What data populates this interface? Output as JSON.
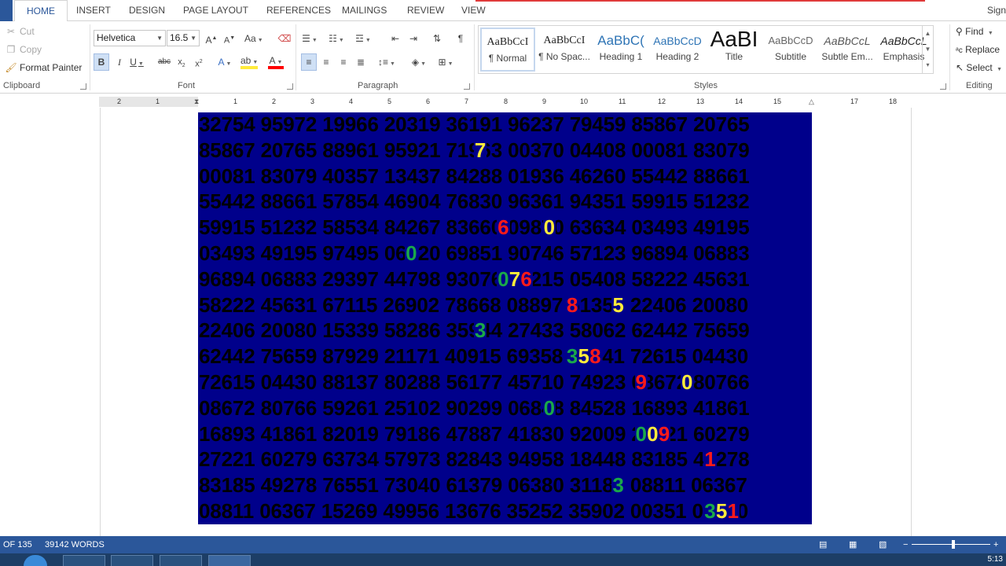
{
  "tabs": [
    "HOME",
    "INSERT",
    "DESIGN",
    "PAGE LAYOUT",
    "REFERENCES",
    "MAILINGS",
    "REVIEW",
    "VIEW"
  ],
  "signin": "Sign",
  "clipboard": {
    "cut": "Cut",
    "copy": "Copy",
    "format_painter": "Format Painter",
    "label": "Clipboard"
  },
  "font": {
    "name": "Helvetica",
    "size": "16.5",
    "label": "Font"
  },
  "paragraph": {
    "label": "Paragraph"
  },
  "styles": {
    "label": "Styles",
    "items": [
      {
        "preview": "AaBbCcI",
        "name": "¶ Normal"
      },
      {
        "preview": "AaBbCcI",
        "name": "¶ No Spac..."
      },
      {
        "preview": "AaBbC(",
        "name": "Heading 1"
      },
      {
        "preview": "AaBbCcD",
        "name": "Heading 2"
      },
      {
        "preview": "AaBI",
        "name": "Title"
      },
      {
        "preview": "AaBbCcD",
        "name": "Subtitle"
      },
      {
        "preview": "AaBbCcL",
        "name": "Subtle Em..."
      },
      {
        "preview": "AaBbCcL",
        "name": "Emphasis"
      }
    ]
  },
  "editing": {
    "find": "Find",
    "replace": "Replace",
    "select": "Select",
    "label": "Editing"
  },
  "ruler": [
    "2",
    "1",
    "1",
    "2",
    "3",
    "4",
    "5",
    "6",
    "7",
    "8",
    "9",
    "10",
    "11",
    "12",
    "13",
    "14",
    "15",
    "17",
    "18"
  ],
  "grid": {
    "rows": [
      "32754 95972 19966 20319 36191 96237 79459 85867 20765",
      "85867 20765 88961 95921 71963 00370 04408 00081 83079",
      "00081 83079 40357 13437 84288 01936 46260 55442 88661",
      "55442 88661 57854 46904 76830 96361 94351 59915 51232",
      "59915 51232 58534 84267 83660 09870 63634 03493 49195",
      "03493 49195 97495 06920 69851 90746 57123 96894 06883",
      "96894 06883 29397 44798 93076 98215 05408 58222 45631",
      "58222 45631 67115 26902 78668 08897 51351 22406 20080",
      "22406 20080 15339 58286 35944 27433 58062 62442 75659",
      "62442 75659 87929 21171 40915 69358 55741 72615 04430",
      "72615 04430 88137 80288 56177 45710 74923 08672 80766",
      "08672 80766 59261 25102 90299 06848 84528 16893 41861",
      "16893 41861 82019 79186 47887 41830 92009 27221 60279",
      "27221 60279 63734 57973 82843 94958 18448 83185 49278",
      "83185 49278 76551 73040 61379 06380 31186 08811 06367",
      "08811 06367 15269 49956 13676 35252 35902 00351 00000"
    ],
    "highlights": [
      {
        "row": 1,
        "col": 24,
        "ch": "7",
        "color": "#ffeb3b"
      },
      {
        "row": 4,
        "col": 26,
        "ch": "6",
        "color": "#ff1a1a"
      },
      {
        "row": 4,
        "col": 30,
        "ch": "0",
        "color": "#ffeb3b"
      },
      {
        "row": 5,
        "col": 18,
        "ch": "0",
        "color": "#1aa84a"
      },
      {
        "row": 6,
        "col": 26,
        "ch": "0",
        "color": "#1aa84a"
      },
      {
        "row": 6,
        "col": 27,
        "ch": "7",
        "color": "#ffeb3b"
      },
      {
        "row": 6,
        "col": 28,
        "ch": "6",
        "color": "#ff1a1a"
      },
      {
        "row": 7,
        "col": 32,
        "ch": "8",
        "color": "#ff1a1a"
      },
      {
        "row": 7,
        "col": 36,
        "ch": "5",
        "color": "#ffeb3b"
      },
      {
        "row": 8,
        "col": 24,
        "ch": "3",
        "color": "#1aa84a"
      },
      {
        "row": 9,
        "col": 32,
        "ch": "3",
        "color": "#1aa84a"
      },
      {
        "row": 9,
        "col": 33,
        "ch": "5",
        "color": "#ffeb3b"
      },
      {
        "row": 9,
        "col": 34,
        "ch": "8",
        "color": "#ff1a1a"
      },
      {
        "row": 10,
        "col": 38,
        "ch": "9",
        "color": "#ff1a1a"
      },
      {
        "row": 10,
        "col": 42,
        "ch": "0",
        "color": "#ffeb3b"
      },
      {
        "row": 11,
        "col": 30,
        "ch": "0",
        "color": "#1aa84a"
      },
      {
        "row": 12,
        "col": 38,
        "ch": "0",
        "color": "#1aa84a"
      },
      {
        "row": 12,
        "col": 39,
        "ch": "0",
        "color": "#ffeb3b"
      },
      {
        "row": 12,
        "col": 40,
        "ch": "9",
        "color": "#ff1a1a"
      },
      {
        "row": 13,
        "col": 44,
        "ch": "1",
        "color": "#ff1a1a"
      },
      {
        "row": 14,
        "col": 36,
        "ch": "3",
        "color": "#1aa84a"
      },
      {
        "row": 15,
        "col": 44,
        "ch": "3",
        "color": "#1aa84a"
      },
      {
        "row": 15,
        "col": 45,
        "ch": "5",
        "color": "#ffeb3b"
      },
      {
        "row": 15,
        "col": 46,
        "ch": "1",
        "color": "#ff1a1a"
      }
    ]
  },
  "status": {
    "page": "OF 135",
    "words": "39142 WORDS"
  },
  "clock": "5:13"
}
